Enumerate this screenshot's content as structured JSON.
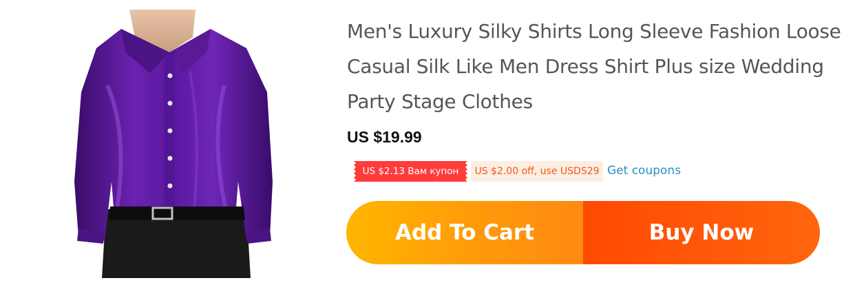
{
  "product": {
    "image_alt": "Purple silky long sleeve men's dress shirt",
    "title": "Men's Luxury Silky Shirts Long Sleeve Fashion Loose Casual Silk Like Men Dress Shirt Plus size Wedding Party Stage Clothes",
    "price": "US $19.99"
  },
  "coupons": {
    "badge_text": "US $2.13 Вам купон",
    "promo_text": "US $2.00 off, use USDS29",
    "link_text": "Get coupons"
  },
  "actions": {
    "add_to_cart_label": "Add To Cart",
    "buy_now_label": "Buy Now"
  },
  "colors": {
    "coupon_badge": "#ff3b3b",
    "promo_text": "#f05a18",
    "promo_bg": "#fdeee4",
    "link": "#2a8ec3",
    "add_to_cart": "#ffa800",
    "buy_now": "#ff5005"
  }
}
